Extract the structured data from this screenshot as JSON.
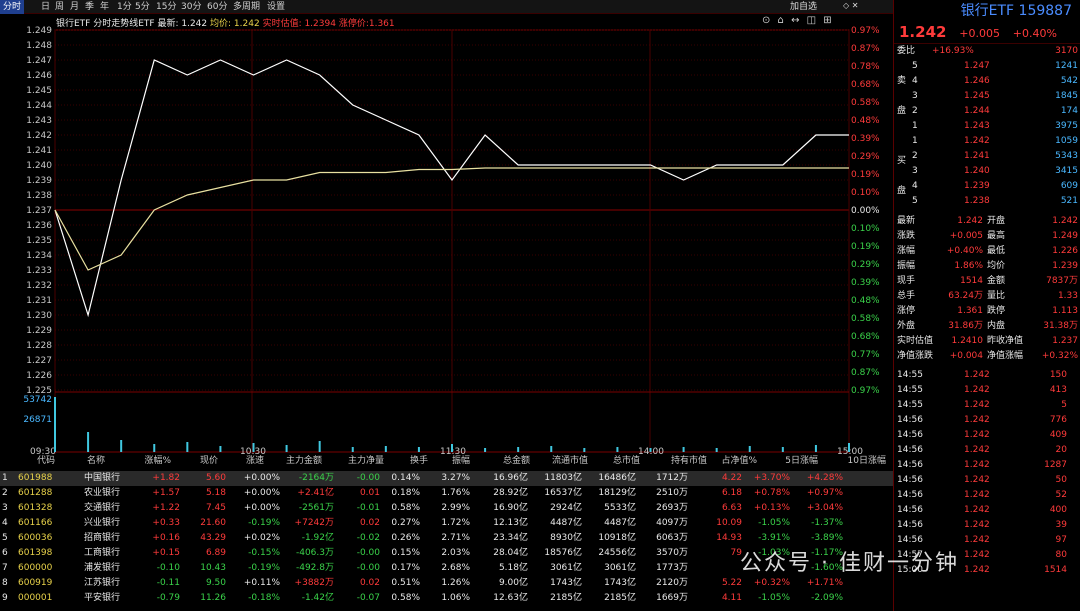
{
  "tabs": [
    "分时",
    "日",
    "周",
    "月",
    "季",
    "年",
    "1分",
    "5分",
    "15分",
    "30分",
    "60分",
    "多周期",
    "设置"
  ],
  "favorite": "加自选",
  "window_ctrl": "◇ ✕",
  "info": {
    "name": "银行ETF 分时走势线ETF",
    "latest": "最新: 1.242",
    "avg": "均价: 1.242",
    "est": "实时估值: 1.2394",
    "limit": "涨停价:1.361"
  },
  "tools": "⊙ ⌂ ↔ ◫ ⊞",
  "axis": {
    "left": [
      "1.249",
      "1.248",
      "1.247",
      "1.246",
      "1.245",
      "1.244",
      "1.243",
      "1.242",
      "1.241",
      "1.240",
      "1.239",
      "1.238",
      "1.237",
      "1.236",
      "1.235",
      "1.234",
      "1.233",
      "1.232",
      "1.231",
      "1.230",
      "1.229",
      "1.228",
      "1.227",
      "1.226",
      "1.225"
    ],
    "right": [
      "0.97%",
      "0.87%",
      "0.78%",
      "0.68%",
      "0.58%",
      "0.48%",
      "0.39%",
      "0.29%",
      "0.19%",
      "0.10%",
      "0.00%",
      "0.10%",
      "0.19%",
      "0.29%",
      "0.39%",
      "0.48%",
      "0.58%",
      "0.68%",
      "0.77%",
      "0.87%",
      "0.97%"
    ],
    "vol": [
      "53742",
      "26871"
    ],
    "time": [
      "09:30",
      "10:30",
      "11:30",
      "14:00",
      "15:00"
    ]
  },
  "chart_data": {
    "type": "line",
    "xlabel": "",
    "ylabel": "",
    "x": [
      "09:30",
      "09:40",
      "09:50",
      "10:00",
      "10:10",
      "10:20",
      "10:30",
      "10:40",
      "10:50",
      "11:00",
      "11:10",
      "11:20",
      "11:30",
      "13:10",
      "13:20",
      "13:30",
      "13:40",
      "13:50",
      "14:00",
      "14:10",
      "14:20",
      "14:30",
      "14:40",
      "14:50",
      "15:00"
    ],
    "series": [
      {
        "name": "最新",
        "values": [
          1.237,
          1.23,
          1.239,
          1.247,
          1.246,
          1.247,
          1.246,
          1.247,
          1.246,
          1.244,
          1.243,
          1.242,
          1.239,
          1.242,
          1.24,
          1.24,
          1.24,
          1.24,
          1.24,
          1.239,
          1.24,
          1.24,
          1.24,
          1.242,
          1.242
        ]
      },
      {
        "name": "均价",
        "values": [
          1.237,
          1.233,
          1.234,
          1.237,
          1.238,
          1.2385,
          1.239,
          1.239,
          1.2395,
          1.2395,
          1.2395,
          1.2397,
          1.2397,
          1.2398,
          1.2398,
          1.2398,
          1.2398,
          1.2398,
          1.2398,
          1.2398,
          1.2398,
          1.2398,
          1.2398,
          1.2398,
          1.2398
        ]
      }
    ],
    "ylim": [
      1.225,
      1.249
    ],
    "prev_close": 1.237
  },
  "right": {
    "title": "银行ETF 159887",
    "price": "1.242",
    "chg": "+0.005",
    "pct": "+0.40%",
    "wb": {
      "label": "委比",
      "val": "+16.93%",
      "num": "3170"
    },
    "sell": [
      {
        "l": "5",
        "p": "1.247",
        "v": "1241"
      },
      {
        "l": "4",
        "p": "1.246",
        "v": "542"
      },
      {
        "l": "3",
        "p": "1.245",
        "v": "1845"
      },
      {
        "l": "2",
        "p": "1.244",
        "v": "174"
      },
      {
        "l": "1",
        "p": "1.243",
        "v": "3975"
      }
    ],
    "buy": [
      {
        "l": "1",
        "p": "1.242",
        "v": "1059"
      },
      {
        "l": "2",
        "p": "1.241",
        "v": "5343"
      },
      {
        "l": "3",
        "p": "1.240",
        "v": "3415"
      },
      {
        "l": "4",
        "p": "1.239",
        "v": "609"
      },
      {
        "l": "5",
        "p": "1.238",
        "v": "521"
      }
    ],
    "sell_label": "卖",
    "sell_label2": "盘",
    "buy_label": "买",
    "buy_label2": "盘",
    "stats": [
      [
        "最新",
        "1.242",
        "开盘",
        "1.242"
      ],
      [
        "涨跌",
        "+0.005",
        "最高",
        "1.249"
      ],
      [
        "涨幅",
        "+0.40%",
        "最低",
        "1.226"
      ],
      [
        "振幅",
        "1.86%",
        "均价",
        "1.239"
      ],
      [
        "现手",
        "1514",
        "金额",
        "7837万"
      ],
      [
        "总手",
        "63.24万",
        "量比",
        "1.33"
      ],
      [
        "涨停",
        "1.361",
        "跌停",
        "1.113"
      ],
      [
        "外盘",
        "31.86万",
        "内盘",
        "31.38万"
      ],
      [
        "实时估值",
        "1.2410",
        "昨收净值",
        "1.237"
      ],
      [
        "净值涨跌",
        "+0.004",
        "净值涨幅",
        "+0.32%"
      ]
    ],
    "ticks": [
      [
        "14:55",
        "1.242",
        "150"
      ],
      [
        "14:55",
        "1.242",
        "413"
      ],
      [
        "14:55",
        "1.242",
        "5"
      ],
      [
        "14:56",
        "1.242",
        "776"
      ],
      [
        "14:56",
        "1.242",
        "409"
      ],
      [
        "14:56",
        "1.242",
        "20"
      ],
      [
        "14:56",
        "1.242",
        "1287"
      ],
      [
        "14:56",
        "1.242",
        "50"
      ],
      [
        "14:56",
        "1.242",
        "52"
      ],
      [
        "14:56",
        "1.242",
        "400"
      ],
      [
        "14:56",
        "1.242",
        "39"
      ],
      [
        "14:56",
        "1.242",
        "97"
      ],
      [
        "14:57",
        "1.242",
        "80"
      ],
      [
        "15:00",
        "1.242",
        "1514"
      ]
    ]
  },
  "table": {
    "headers": [
      "代码",
      "名称",
      "涨幅%",
      "现价",
      "涨速",
      "主力金额",
      "主力净量",
      "换手",
      "振幅",
      "总金额",
      "流通市值",
      "总市值",
      "持有市值",
      "占净值%",
      "5日涨幅",
      "10日涨幅"
    ],
    "rows": [
      [
        "1",
        "601988",
        "中国银行",
        "+1.82",
        "5.60",
        "+0.00%",
        "-2164万",
        "-0.00",
        "0.14%",
        "3.27%",
        "16.96亿",
        "11803亿",
        "16486亿",
        "1712万",
        "4.22",
        "+3.70%",
        "+4.28%"
      ],
      [
        "2",
        "601288",
        "农业银行",
        "+1.57",
        "5.18",
        "+0.00%",
        "+2.41亿",
        "0.01",
        "0.18%",
        "1.76%",
        "28.92亿",
        "16537亿",
        "18129亿",
        "2510万",
        "6.18",
        "+0.78%",
        "+0.97%"
      ],
      [
        "3",
        "601328",
        "交通银行",
        "+1.22",
        "7.45",
        "+0.00%",
        "-2561万",
        "-0.01",
        "0.58%",
        "2.99%",
        "16.90亿",
        "2924亿",
        "5533亿",
        "2693万",
        "6.63",
        "+0.13%",
        "+3.04%"
      ],
      [
        "4",
        "601166",
        "兴业银行",
        "+0.33",
        "21.60",
        "-0.19%",
        "+7242万",
        "0.02",
        "0.27%",
        "1.72%",
        "12.13亿",
        "4487亿",
        "4487亿",
        "4097万",
        "10.09",
        "-1.05%",
        "-1.37%"
      ],
      [
        "5",
        "600036",
        "招商银行",
        "+0.16",
        "43.29",
        "+0.02%",
        "-1.92亿",
        "-0.02",
        "0.26%",
        "2.71%",
        "23.34亿",
        "8930亿",
        "10918亿",
        "6063万",
        "14.93",
        "-3.91%",
        "-3.89%"
      ],
      [
        "6",
        "601398",
        "工商银行",
        "+0.15",
        "6.89",
        "-0.15%",
        "-406.3万",
        "-0.00",
        "0.15%",
        "2.03%",
        "28.04亿",
        "18576亿",
        "24556亿",
        "3570万",
        "79",
        "-1.03%",
        "-1.17%"
      ],
      [
        "7",
        "600000",
        "浦发银行",
        "-0.10",
        "10.43",
        "-0.19%",
        "-492.8万",
        "-0.00",
        "0.17%",
        "2.68%",
        "5.18亿",
        "3061亿",
        "3061亿",
        "1773万",
        "",
        "",
        "-1.60%"
      ],
      [
        "8",
        "600919",
        "江苏银行",
        "-0.11",
        "9.50",
        "+0.11%",
        "+3882万",
        "0.02",
        "0.51%",
        "1.26%",
        "9.00亿",
        "1743亿",
        "1743亿",
        "2120万",
        "5.22",
        "+0.32%",
        "+1.71%"
      ],
      [
        "9",
        "000001",
        "平安银行",
        "-0.79",
        "11.26",
        "-0.18%",
        "-1.42亿",
        "-0.07",
        "0.58%",
        "1.06%",
        "12.63亿",
        "2185亿",
        "2185亿",
        "1669万",
        "4.11",
        "-1.05%",
        "-2.09%"
      ]
    ]
  },
  "watermark": "公众号 · 佳财一分钟"
}
